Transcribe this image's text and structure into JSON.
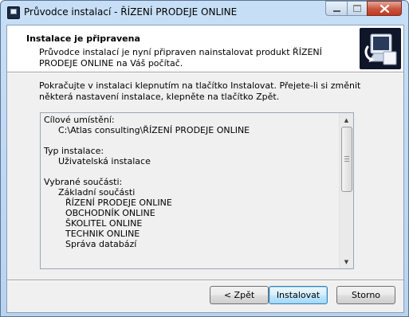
{
  "window": {
    "title": "Průvodce instalací - ŘÍZENÍ PRODEJE ONLINE"
  },
  "header": {
    "title": "Instalace je připravena",
    "description": "Průvodce instalací je nyní připraven nainstalovat produkt ŘÍZENÍ PRODEJE ONLINE na Váš počítač."
  },
  "intro": "Pokračujte v instalaci klepnutím na tlačítko Instalovat. Přejete-li si změnit některá nastavení instalace, klepněte na tlačítko Zpět.",
  "summary": {
    "destination_label": "Cílové umístění:",
    "destination_value": "C:\\Atlas consulting\\ŘÍZENÍ PRODEJE ONLINE",
    "type_label": "Typ instalace:",
    "type_value": "Uživatelská instalace",
    "components_label": "Vybrané součásti:",
    "components_group": "Základní součásti",
    "components": [
      "ŘÍZENÍ PRODEJE ONLINE",
      "OBCHODNÍK ONLINE",
      "ŠKOLITEL ONLINE",
      "TECHNIK ONLINE",
      "Správa databází"
    ]
  },
  "buttons": {
    "back": "< Zpět",
    "install": "Instalovat",
    "cancel": "Storno"
  },
  "icons": {
    "app": "installer-app-icon",
    "header": "computer-setup-icon",
    "scroll_up": "scroll-up-arrow-icon",
    "scroll_down": "scroll-down-arrow-icon"
  },
  "colors": {
    "title_bar": "#c7dff6",
    "close_button": "#c9543e",
    "header_image_bg": "#10162a",
    "default_button_border": "#3c7fb1"
  }
}
